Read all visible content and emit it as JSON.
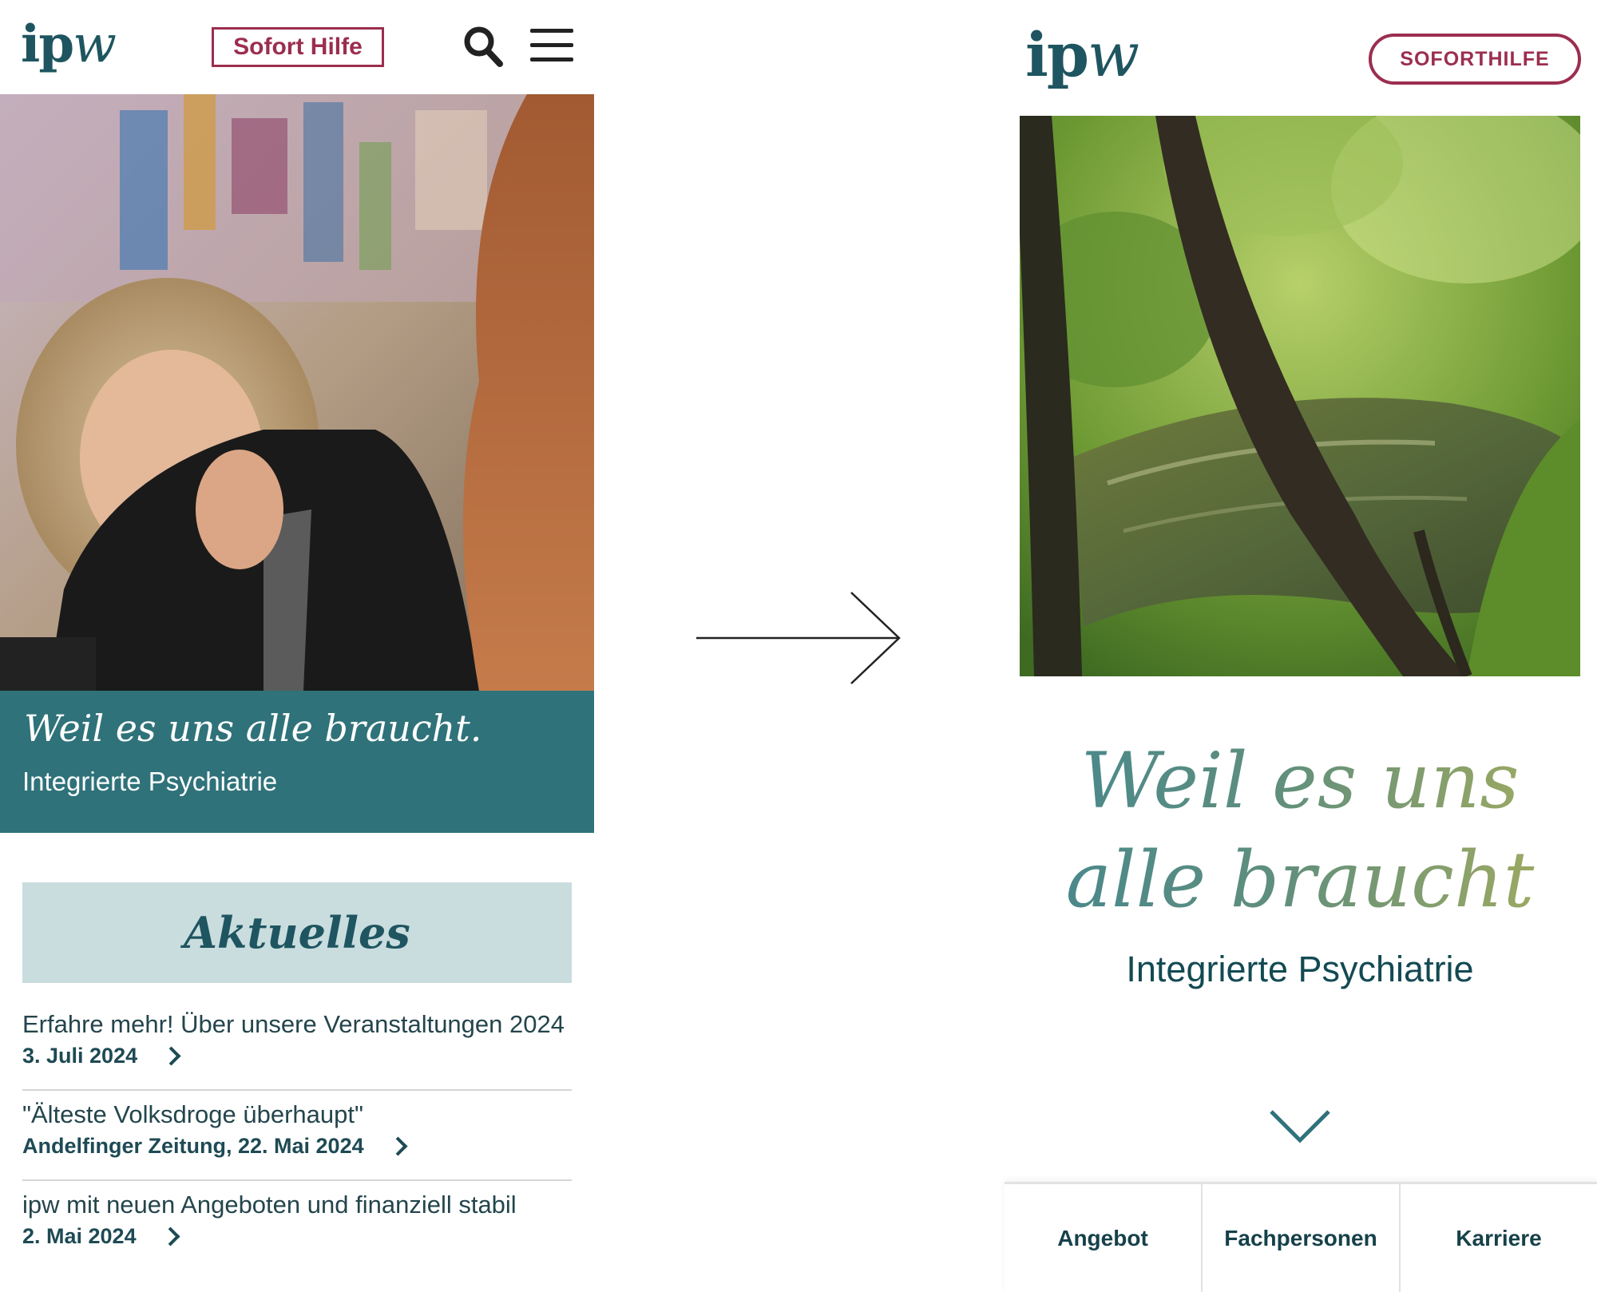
{
  "left": {
    "header": {
      "logo": "ipw",
      "sofort_hilfe": "Sofort Hilfe",
      "icons": [
        "search-icon",
        "hamburger-menu-icon"
      ]
    },
    "hero": {
      "title": "Weil es uns alle braucht.",
      "subtitle": "Integrierte Psychiatrie"
    },
    "news": {
      "heading": "Aktuelles",
      "items": [
        {
          "title": "Erfahre mehr! Über unsere Veranstaltungen 2024",
          "meta": "3. Juli 2024"
        },
        {
          "title": "\"Älteste Volksdroge überhaupt\"",
          "meta": "Andelfinger Zeitung, 22. Mai 2024"
        },
        {
          "title": "ipw mit neuen Angeboten und finanziell stabil",
          "meta": "2. Mai 2024"
        }
      ]
    }
  },
  "right": {
    "header": {
      "logo": "ipw",
      "soforthilfe": "SOFORTHILFE"
    },
    "hero": {
      "title": "Weil es uns alle braucht",
      "subtitle": "Integrierte Psychiatrie"
    },
    "nav": [
      "Angebot",
      "Fachpersonen",
      "Karriere"
    ]
  },
  "colors": {
    "accent": "#9b2e4f",
    "teal": "#2f727a",
    "teal_light": "#c9dcde",
    "text_dark": "#1e4a54"
  }
}
